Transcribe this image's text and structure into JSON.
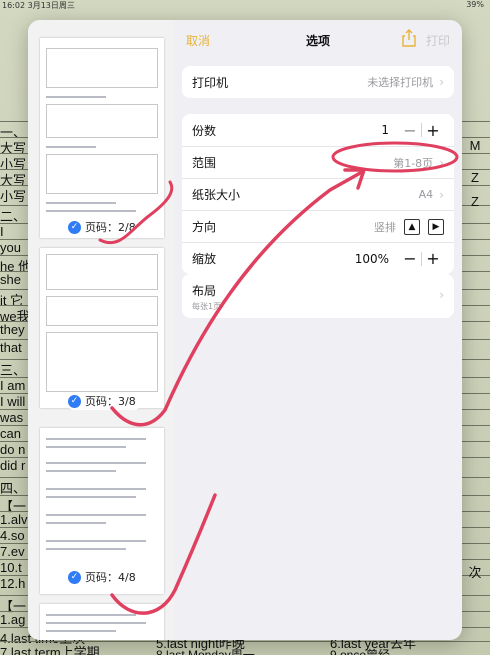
{
  "status": {
    "time": "16:02",
    "date": "3月13日周三",
    "battery": "39%"
  },
  "background": {
    "left_lines": [
      "一、",
      "大写",
      "小写",
      "大写",
      "小写",
      "二、",
      "I",
      "you",
      "he 他",
      "she",
      "it 它",
      "we我",
      "they",
      "that",
      "三、",
      "I am",
      "I will",
      "was",
      "can",
      "do n",
      "did r",
      "四、",
      "【一",
      "1.alv",
      "4.so",
      "7.ev",
      "10.t",
      "12.h",
      "【一",
      "1.ag",
      "4.last time上次",
      "7.last term上学期"
    ],
    "right_letters": [
      "M",
      "Z",
      "Z",
      "次"
    ],
    "bottom_middle": [
      "5.last night昨晚",
      "8.last Monday周一"
    ],
    "bottom_right": [
      "6.last year去年",
      "9.once曾经"
    ]
  },
  "dialog": {
    "nav": {
      "cancel": "取消",
      "title": "选项",
      "print": "打印",
      "share_icon": "share-icon"
    },
    "printer": {
      "label": "打印机",
      "value": "未选择打印机"
    },
    "copies": {
      "label": "份数",
      "value": "1"
    },
    "range": {
      "label": "范围",
      "value": "第1-8页"
    },
    "paper": {
      "label": "纸张大小",
      "value": "A4"
    },
    "orientation": {
      "label": "方向",
      "value": "竖排"
    },
    "scale": {
      "label": "缩放",
      "value": "100%"
    },
    "layout": {
      "label": "布局",
      "sub": "每张1页"
    },
    "pages": [
      {
        "badge": "页码：2/8"
      },
      {
        "badge": "页码：3/8"
      },
      {
        "badge": "页码：4/8"
      }
    ]
  },
  "colors": {
    "accent": "#e8b33a",
    "annotation": "#e0405f",
    "check": "#2f7cf6"
  }
}
